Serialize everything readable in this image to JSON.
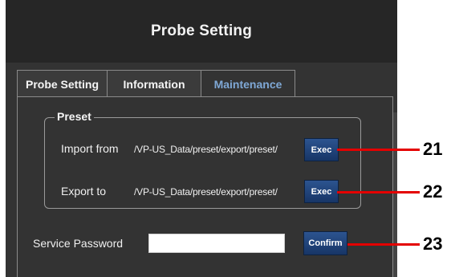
{
  "window": {
    "title": "Probe Setting"
  },
  "tabs": [
    {
      "label": "Probe Setting",
      "active": false
    },
    {
      "label": "Information",
      "active": false
    },
    {
      "label": "Maintenance",
      "active": true
    }
  ],
  "preset": {
    "legend": "Preset",
    "import_label": "Import from",
    "import_path": "/VP-US_Data/preset/export/preset/",
    "import_button": "Exec",
    "export_label": "Export to",
    "export_path": "/VP-US_Data/preset/export/preset/",
    "export_button": "Exec"
  },
  "service": {
    "label": "Service Password",
    "password_value": "",
    "confirm_button": "Confirm"
  },
  "callouts": [
    "21",
    "22",
    "23"
  ],
  "colors": {
    "panel": "#333333",
    "titlebar": "#262626",
    "active_tab_text": "#7fa8d6",
    "button": "#1f4079",
    "callout_line": "#e40000"
  }
}
